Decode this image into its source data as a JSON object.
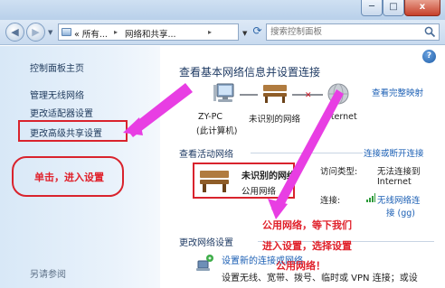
{
  "window": {
    "min_label": "─",
    "max_label": "□",
    "close_label": "x"
  },
  "address_bar": {
    "segments": [
      "« 所有...",
      "网络和共享..."
    ],
    "separator": "▸",
    "search_placeholder": "搜索控制面板"
  },
  "sidebar": {
    "home": "控制面板主页",
    "items": [
      "管理无线网络",
      "更改适配器设置",
      "更改高级共享设置"
    ],
    "see_also": "另请参阅"
  },
  "main": {
    "title": "查看基本网络信息并设置连接",
    "full_map_link": "查看完整映射",
    "nodes": {
      "computer": "ZY-PC",
      "computer_sub": "(此计算机)",
      "network": "未识别的网络",
      "internet": "Internet"
    },
    "active_heading": "查看活动网络",
    "connect_link": "连接或断开连接",
    "network_card": {
      "name": "未识别的网络",
      "type": "公用网络"
    },
    "access_type_label": "访问类型:",
    "access_type_value": "无法连接到",
    "access_type_value2": "Internet",
    "connections_label": "连接:",
    "connection_value": "无线网络连",
    "connection_value2": "接 (gg)",
    "change_heading": "更改网络设置",
    "setup_link": "设置新的连接或网络",
    "setup_desc": "设置无线、宽带、拨号、临时或 VPN 连接；或设"
  },
  "annotations": {
    "click_note": "单击，进入设置",
    "public_note_1": "公用网络，等下我们",
    "public_note_2": "进入设置，选择设置",
    "public_note_3": "公用网络！"
  },
  "colors": {
    "accent_red": "#d9232d",
    "annotation_magenta": "#e83ee3",
    "link_blue": "#1b5fb4"
  }
}
